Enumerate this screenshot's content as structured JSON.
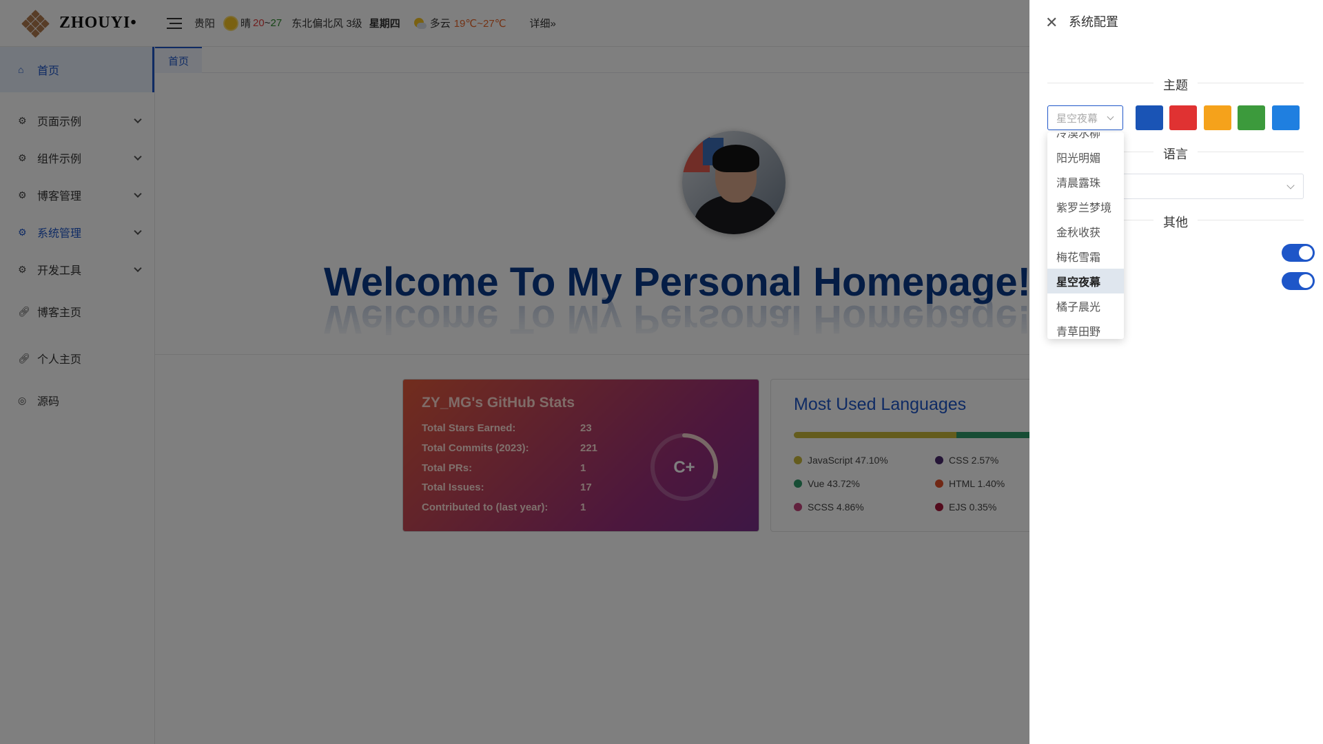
{
  "header": {
    "logo_text": "ZHOUYI•",
    "weather": {
      "city": "贵阳",
      "today_cond": "晴",
      "today_high": "20",
      "today_sep": "~",
      "today_low": "27",
      "wind": "东北偏北风 3级",
      "weekday": "星期四",
      "tomorrow_cond": "多云",
      "tomorrow_range": "19℃~27℃",
      "more": "详细»"
    }
  },
  "sidebar": {
    "items": [
      {
        "label": "首页",
        "icon": "home-icon"
      },
      {
        "label": "页面示例",
        "icon": "gear-icon"
      },
      {
        "label": "组件示例",
        "icon": "gear-icon"
      },
      {
        "label": "博客管理",
        "icon": "gear-icon"
      },
      {
        "label": "系统管理",
        "icon": "gear-icon"
      },
      {
        "label": "开发工具",
        "icon": "gear-icon"
      },
      {
        "label": "博客主页",
        "icon": "link-icon"
      },
      {
        "label": "个人主页",
        "icon": "link-icon"
      },
      {
        "label": "源码",
        "icon": "github-icon"
      }
    ]
  },
  "tabs": {
    "home": "首页"
  },
  "main": {
    "welcome": "Welcome To My Personal Homepage! Le",
    "stats": {
      "title": "ZY_MG's GitHub Stats",
      "rows": [
        {
          "label": "Total Stars Earned:",
          "value": "23"
        },
        {
          "label": "Total Commits (2023):",
          "value": "221"
        },
        {
          "label": "Total PRs:",
          "value": "1"
        },
        {
          "label": "Total Issues:",
          "value": "17"
        },
        {
          "label": "Contributed to (last year):",
          "value": "1"
        }
      ],
      "rank": "C+",
      "rank_progress": 0.3
    },
    "languages": {
      "title": "Most Used Languages",
      "items": [
        {
          "name": "JavaScript 47.10%",
          "pct": 47.1,
          "color": "#c9b83a"
        },
        {
          "name": "Vue 43.72%",
          "pct": 43.72,
          "color": "#2e9a6a"
        },
        {
          "name": "SCSS 4.86%",
          "pct": 4.86,
          "color": "#c3427a"
        },
        {
          "name": "CSS 2.57%",
          "pct": 2.57,
          "color": "#4a2b6e"
        },
        {
          "name": "HTML 1.40%",
          "pct": 1.4,
          "color": "#e2512a"
        },
        {
          "name": "EJS 0.35%",
          "pct": 0.35,
          "color": "#a6173a"
        }
      ]
    }
  },
  "drawer": {
    "title": "系统配置",
    "theme_section": "主题",
    "theme_select_value": "星空夜幕",
    "theme_colors": [
      "#1a54b5",
      "#e03232",
      "#f5a21b",
      "#3c9a3c",
      "#1f7fe0"
    ],
    "language_section": "语言",
    "other_section": "其他",
    "toggle1_on": true,
    "toggle2_on": true,
    "dropdown_items": [
      "冷漠水柳",
      "阳光明媚",
      "清晨露珠",
      "紫罗兰梦境",
      "金秋收获",
      "梅花雪霜",
      "星空夜幕",
      "橘子晨光",
      "青草田野"
    ],
    "dropdown_selected": "星空夜幕"
  }
}
